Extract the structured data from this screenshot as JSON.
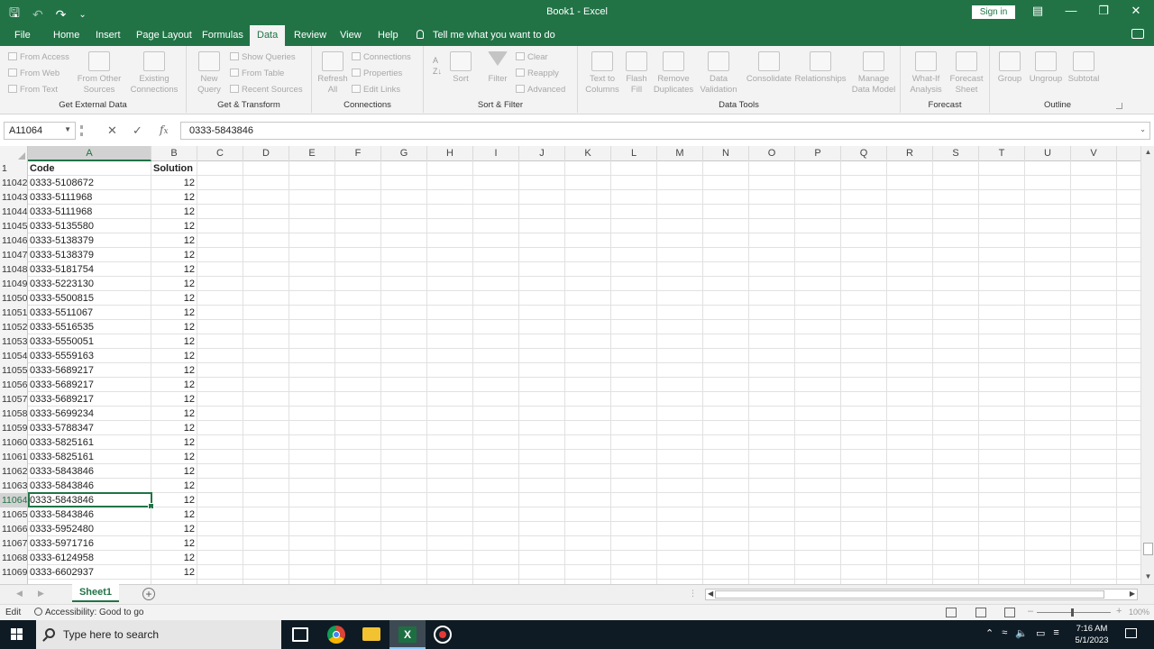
{
  "window": {
    "title": "Book1  -  Excel",
    "sign_in": "Sign in"
  },
  "ribbon": {
    "tabs": [
      "File",
      "Home",
      "Insert",
      "Page Layout",
      "Formulas",
      "Data",
      "Review",
      "View",
      "Help"
    ],
    "active_tab": "Data",
    "tell_me": "Tell me what you want to do",
    "groups": {
      "get_external": {
        "label": "Get External Data",
        "from_access": "From Access",
        "from_web": "From Web",
        "from_text": "From Text",
        "from_other_1": "From Other",
        "from_other_2": "Sources",
        "existing_1": "Existing",
        "existing_2": "Connections"
      },
      "get_transform": {
        "label": "Get & Transform",
        "new_query_1": "New",
        "new_query_2": "Query",
        "show_queries": "Show Queries",
        "from_table": "From Table",
        "recent_sources": "Recent Sources"
      },
      "connections": {
        "label": "Connections",
        "refresh_1": "Refresh",
        "refresh_2": "All",
        "connections": "Connections",
        "properties": "Properties",
        "edit_links": "Edit Links"
      },
      "sort_filter": {
        "label": "Sort & Filter",
        "sort": "Sort",
        "filter": "Filter",
        "clear": "Clear",
        "reapply": "Reapply",
        "advanced": "Advanced"
      },
      "data_tools": {
        "label": "Data Tools",
        "text_to_columns_1": "Text to",
        "text_to_columns_2": "Columns",
        "flash_fill_1": "Flash",
        "flash_fill_2": "Fill",
        "remove_dup_1": "Remove",
        "remove_dup_2": "Duplicates",
        "validation_1": "Data",
        "validation_2": "Validation",
        "consolidate": "Consolidate",
        "relationships": "Relationships",
        "manage_1": "Manage",
        "manage_2": "Data Model"
      },
      "forecast": {
        "label": "Forecast",
        "whatif_1": "What-If",
        "whatif_2": "Analysis",
        "sheet_1": "Forecast",
        "sheet_2": "Sheet"
      },
      "outline": {
        "label": "Outline",
        "group": "Group",
        "ungroup": "Ungroup",
        "subtotal": "Subtotal"
      }
    }
  },
  "formula_bar": {
    "name_box": "A11064",
    "formula": "0333-5843846"
  },
  "sheet": {
    "columns": [
      "A",
      "B",
      "C",
      "D",
      "E",
      "F",
      "G",
      "H",
      "I",
      "J",
      "K",
      "L",
      "M",
      "N",
      "O",
      "P",
      "Q",
      "R",
      "S",
      "T",
      "U",
      "V"
    ],
    "selected_column": "A",
    "header_row": {
      "num": "1",
      "a": "Code",
      "b": "Solution"
    },
    "selected_row": "11064",
    "rows": [
      {
        "num": "11042",
        "a": "0333-5108672",
        "b": "12"
      },
      {
        "num": "11043",
        "a": "0333-5111968",
        "b": "12"
      },
      {
        "num": "11044",
        "a": "0333-5111968",
        "b": "12"
      },
      {
        "num": "11045",
        "a": "0333-5135580",
        "b": "12"
      },
      {
        "num": "11046",
        "a": "0333-5138379",
        "b": "12"
      },
      {
        "num": "11047",
        "a": "0333-5138379",
        "b": "12"
      },
      {
        "num": "11048",
        "a": "0333-5181754",
        "b": "12"
      },
      {
        "num": "11049",
        "a": "0333-5223130",
        "b": "12"
      },
      {
        "num": "11050",
        "a": "0333-5500815",
        "b": "12"
      },
      {
        "num": "11051",
        "a": "0333-5511067",
        "b": "12"
      },
      {
        "num": "11052",
        "a": "0333-5516535",
        "b": "12"
      },
      {
        "num": "11053",
        "a": "0333-5550051",
        "b": "12"
      },
      {
        "num": "11054",
        "a": "0333-5559163",
        "b": "12"
      },
      {
        "num": "11055",
        "a": "0333-5689217",
        "b": "12"
      },
      {
        "num": "11056",
        "a": "0333-5689217",
        "b": "12"
      },
      {
        "num": "11057",
        "a": "0333-5689217",
        "b": "12"
      },
      {
        "num": "11058",
        "a": "0333-5699234",
        "b": "12"
      },
      {
        "num": "11059",
        "a": "0333-5788347",
        "b": "12"
      },
      {
        "num": "11060",
        "a": "0333-5825161",
        "b": "12"
      },
      {
        "num": "11061",
        "a": "0333-5825161",
        "b": "12"
      },
      {
        "num": "11062",
        "a": "0333-5843846",
        "b": "12"
      },
      {
        "num": "11063",
        "a": "0333-5843846",
        "b": "12"
      },
      {
        "num": "11064",
        "a": "0333-5843846",
        "b": "12"
      },
      {
        "num": "11065",
        "a": "0333-5843846",
        "b": "12"
      },
      {
        "num": "11066",
        "a": "0333-5952480",
        "b": "12"
      },
      {
        "num": "11067",
        "a": "0333-5971716",
        "b": "12"
      },
      {
        "num": "11068",
        "a": "0333-6124958",
        "b": "12"
      },
      {
        "num": "11069",
        "a": "0333-6602937",
        "b": "12"
      }
    ],
    "tab_name": "Sheet1"
  },
  "status": {
    "mode": "Edit",
    "accessibility": "Accessibility: Good to go",
    "zoom": "100%"
  },
  "taskbar": {
    "search_placeholder": "Type here to search",
    "time": "7:16 AM",
    "date": "5/1/2023"
  },
  "colors": {
    "excel_green": "#217346",
    "taskbar": "#0f1b24"
  }
}
